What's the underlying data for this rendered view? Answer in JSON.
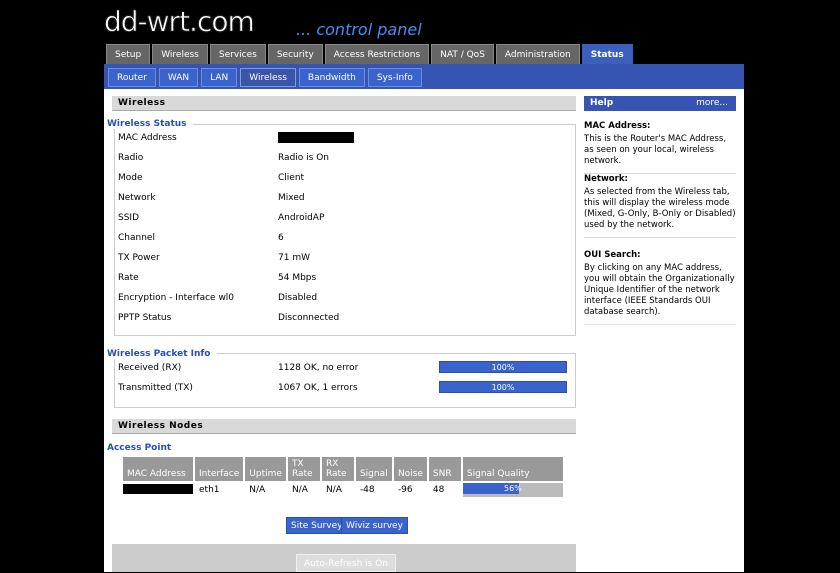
{
  "logo": {
    "name": "dd-wrt.com",
    "tagline": "... control panel"
  },
  "main_tabs": [
    "Setup",
    "Wireless",
    "Services",
    "Security",
    "Access Restrictions",
    "NAT / QoS",
    "Administration",
    "Status"
  ],
  "sub_tabs": [
    "Router",
    "WAN",
    "LAN",
    "Wireless",
    "Bandwidth",
    "Sys-Info"
  ],
  "wireless": {
    "header": "Wireless",
    "status_legend": "Wireless Status",
    "rows": [
      {
        "label": "MAC Address",
        "value": ""
      },
      {
        "label": "Radio",
        "value": "Radio is On"
      },
      {
        "label": "Mode",
        "value": "Client"
      },
      {
        "label": "Network",
        "value": "Mixed"
      },
      {
        "label": "SSID",
        "value": "AndroidAP"
      },
      {
        "label": "Channel",
        "value": "6"
      },
      {
        "label": "TX Power",
        "value": "71 mW"
      },
      {
        "label": "Rate",
        "value": "54 Mbps"
      },
      {
        "label": "Encryption - Interface wl0",
        "value": "Disabled"
      },
      {
        "label": "PPTP Status",
        "value": "Disconnected"
      }
    ]
  },
  "packet_info": {
    "legend": "Wireless Packet Info",
    "rows": [
      {
        "label": "Received (RX)",
        "value": "1128 OK, no error",
        "percent": "100%"
      },
      {
        "label": "Transmitted (TX)",
        "value": "1067 OK, 1 errors",
        "percent": "100%"
      }
    ]
  },
  "nodes": {
    "header": "Wireless Nodes",
    "legend": "Access Point",
    "columns": [
      "MAC Address",
      "Interface",
      "Uptime",
      "TX Rate",
      "RX Rate",
      "Signal",
      "Noise",
      "SNR",
      "Signal Quality"
    ],
    "row": {
      "mac": "",
      "interface": "eth1",
      "uptime": "N/A",
      "tx": "N/A",
      "rx": "N/A",
      "signal": "-48",
      "noise": "-96",
      "snr": "48",
      "quality": "56%",
      "quality_fraction": 0.56
    }
  },
  "buttons": {
    "site_survey": "Site Survey",
    "wiviz": "Wiviz survey",
    "auto_refresh": "Auto-Refresh is On"
  },
  "help": {
    "title": "Help",
    "more": "more...",
    "sections": [
      {
        "title": "MAC Address:",
        "text": "This is the Router's MAC Address, as seen on your local, wireless network."
      },
      {
        "title": "Network:",
        "text": "As selected from the Wireless tab, this will display the wireless mode (Mixed, G-Only, B-Only or Disabled) used by the network."
      },
      {
        "title": "OUI Search:",
        "text": "By clicking on any MAC address, you will obtain the Organizationally Unique Identifier of the network interface (IEEE Standards OUI database search)."
      }
    ]
  },
  "colors": {
    "accent": "#3b63cc",
    "band": "#3655b3",
    "background": "#000000"
  }
}
